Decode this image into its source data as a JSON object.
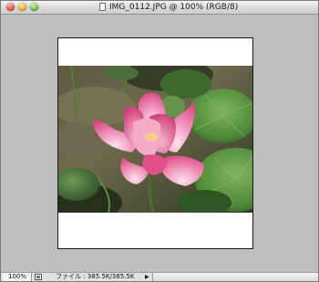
{
  "window": {
    "title": "IMG_0112.JPG @ 100% (RGB/8)"
  },
  "document": {
    "image_subject": "lotus-flower-photo",
    "colors": {
      "petal": "#e8649a",
      "leaf": "#4f8a3a",
      "canvas": "#ffffff",
      "pasteboard": "#bfbfbf"
    }
  },
  "statusbar": {
    "zoom": "100%",
    "file_info": "ファイル : 385.5K/385.5K",
    "menu_arrow": "▶"
  },
  "icons": {
    "close": "close-icon",
    "minimize": "minimize-icon",
    "zoom": "zoom-icon",
    "document": "document-icon",
    "status": "status-preview-icon"
  }
}
